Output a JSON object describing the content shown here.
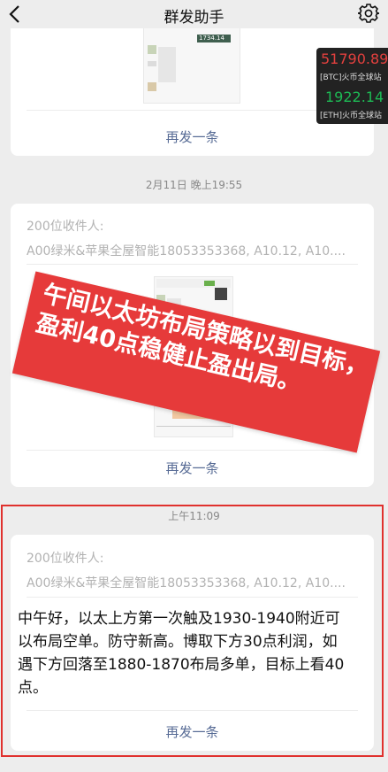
{
  "header": {
    "title": "群发助手"
  },
  "ticker": {
    "btc_value": "51790.89",
    "btc_label": "[BTC]火币全球站",
    "eth_value": "1922.14",
    "eth_label": "[ETH]火币全球站"
  },
  "card1": {
    "thumb_text": "1734.14",
    "resend_label": "再发一条"
  },
  "group2": {
    "time": "2月11日 晚上19:55",
    "recipients_label": "200位收件人:",
    "recipients_names": "A00绿米&苹果全屋智能18053353368, A10.12, A10....",
    "resend_label": "再发一条"
  },
  "banner": {
    "text": "午间以太坊布局策略以到目标，盈利40点稳健止盈出局。"
  },
  "group3": {
    "time": "上午11:09",
    "recipients_label": "200位收件人:",
    "recipients_names": "A00绿米&苹果全屋智能18053353368, A10.12, A10....",
    "message": "中午好，以太上方第一次触及1930-1940附近可以布局空单。防守新高。博取下方30点利润，如遇下方回落至1880-1870布局多单，目标上看40点。",
    "resend_label": "再发一条"
  }
}
